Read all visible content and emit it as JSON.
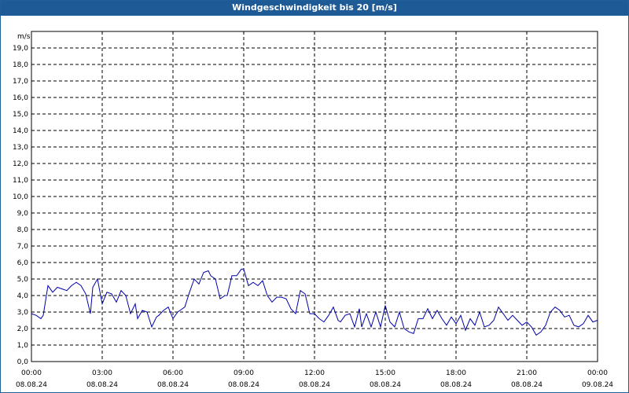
{
  "window": {
    "title": "Windgeschwindigkeit bis 20 [m/s]"
  },
  "colors": {
    "titlebar": "#1e5a96",
    "series": "#0000aa",
    "grid": "#000000"
  },
  "chart_data": {
    "type": "line",
    "title": "Windgeschwindigkeit bis 20 [m/s]",
    "ylabel": "m/s",
    "xlabel": "",
    "ylim": [
      0,
      20
    ],
    "xlim": [
      0,
      24
    ],
    "grid": true,
    "y_ticks": [
      "0,0",
      "1,0",
      "2,0",
      "3,0",
      "4,0",
      "5,0",
      "6,0",
      "7,0",
      "8,0",
      "9,0",
      "10,0",
      "11,0",
      "12,0",
      "13,0",
      "14,0",
      "15,0",
      "16,0",
      "17,0",
      "18,0",
      "19,0"
    ],
    "x_ticks": [
      {
        "time": "00:00",
        "date": "08.08.24"
      },
      {
        "time": "03:00",
        "date": "08.08.24"
      },
      {
        "time": "06:00",
        "date": "08.08.24"
      },
      {
        "time": "09:00",
        "date": "08.08.24"
      },
      {
        "time": "12:00",
        "date": "08.08.24"
      },
      {
        "time": "15:00",
        "date": "08.08.24"
      },
      {
        "time": "18:00",
        "date": "08.08.24"
      },
      {
        "time": "21:00",
        "date": "08.08.24"
      },
      {
        "time": "00:00",
        "date": "09.08.24"
      }
    ],
    "series": [
      {
        "x": [
          0,
          0.2,
          0.4,
          0.5,
          0.7,
          0.9,
          1.1,
          1.3,
          1.5,
          1.7,
          1.9,
          2.1,
          2.3,
          2.5,
          2.6,
          2.8,
          3.0,
          3.2,
          3.4,
          3.6,
          3.8,
          4.0,
          4.2,
          4.4,
          4.5,
          4.7,
          4.9,
          5.1,
          5.3,
          5.4,
          5.6,
          5.8,
          6.0,
          6.2,
          6.3,
          6.5,
          6.7,
          6.9,
          7.1,
          7.3,
          7.5,
          7.6,
          7.8,
          8.0,
          8.2,
          8.3,
          8.5,
          8.7,
          8.9,
          9.0,
          9.2,
          9.4,
          9.6,
          9.8,
          10.0,
          10.2,
          10.4,
          10.6,
          10.8,
          11.0,
          11.2,
          11.4,
          11.6,
          11.8,
          12.0,
          12.2,
          12.4,
          12.6,
          12.8,
          13.0,
          13.1,
          13.3,
          13.5,
          13.7,
          13.9,
          14.0,
          14.2,
          14.4,
          14.6,
          14.8,
          15.0,
          15.2,
          15.4,
          15.6,
          15.8,
          16.0,
          16.2,
          16.4,
          16.6,
          16.8,
          17.0,
          17.2,
          17.4,
          17.6,
          17.8,
          18.0,
          18.2,
          18.4,
          18.6,
          18.8,
          19.0,
          19.2,
          19.4,
          19.6,
          19.8,
          20.0,
          20.2,
          20.4,
          20.6,
          20.8,
          21.0,
          21.2,
          21.4,
          21.6,
          21.8,
          22.0,
          22.2,
          22.4,
          22.6,
          22.8,
          23.0,
          23.2,
          23.4,
          23.6,
          23.8,
          24.0
        ],
        "y": [
          2.9,
          2.8,
          2.6,
          2.8,
          4.6,
          4.2,
          4.5,
          4.4,
          4.3,
          4.6,
          4.8,
          4.6,
          4.1,
          2.9,
          4.5,
          5.0,
          3.5,
          4.2,
          4.1,
          3.6,
          4.3,
          4.0,
          2.9,
          3.5,
          2.6,
          3.1,
          3.0,
          2.1,
          2.7,
          2.8,
          3.1,
          3.3,
          2.6,
          3.0,
          3.1,
          3.3,
          4.2,
          5.0,
          4.7,
          5.4,
          5.5,
          5.2,
          5.0,
          3.8,
          4.0,
          4.0,
          5.2,
          5.2,
          5.6,
          5.6,
          4.6,
          4.8,
          4.6,
          4.9,
          4.0,
          3.6,
          3.9,
          3.9,
          3.8,
          3.2,
          2.9,
          4.3,
          4.1,
          2.9,
          2.9,
          2.6,
          2.4,
          2.8,
          3.3,
          2.5,
          2.4,
          2.8,
          2.9,
          2.1,
          3.2,
          2.1,
          2.9,
          2.1,
          3.0,
          2.1,
          3.4,
          2.4,
          2.1,
          3.0,
          2.0,
          1.8,
          1.7,
          2.6,
          2.6,
          3.2,
          2.6,
          3.1,
          2.6,
          2.2,
          2.7,
          2.3,
          2.8,
          1.9,
          2.6,
          2.2,
          3.0,
          2.1,
          2.2,
          2.5,
          3.3,
          2.9,
          2.5,
          2.8,
          2.5,
          2.2,
          2.4,
          2.1,
          1.6,
          1.8,
          2.2,
          3.0,
          3.3,
          3.1,
          2.7,
          2.8,
          2.2,
          2.1,
          2.3,
          2.8,
          2.4,
          2.5
        ]
      }
    ]
  }
}
